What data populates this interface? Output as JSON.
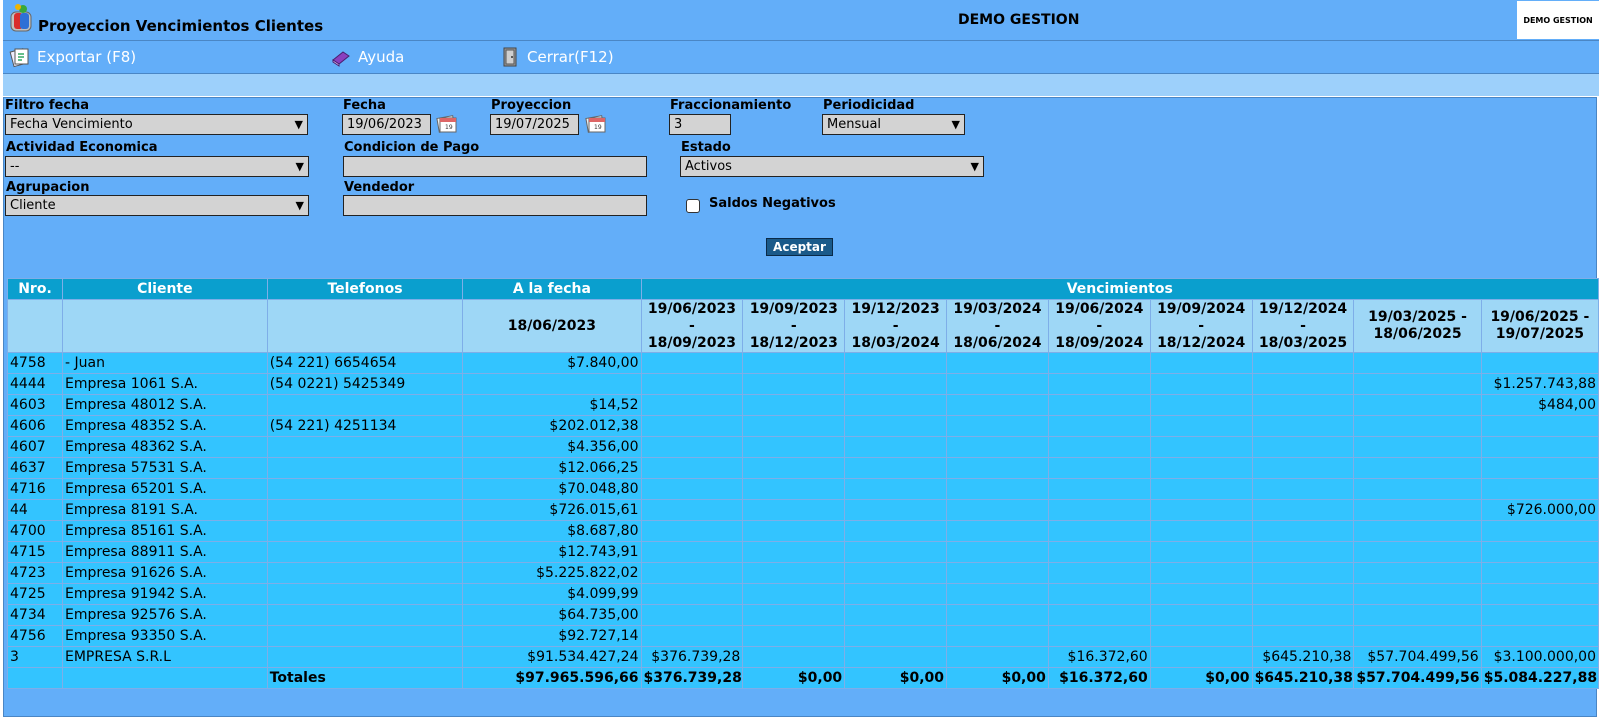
{
  "window": {
    "title": "Proyeccion Vencimientos Clientes",
    "company": "DEMO GESTION",
    "brand_box": "DEMO GESTION"
  },
  "toolbar": {
    "export": "Exportar (F8)",
    "help": "Ayuda",
    "close": "Cerrar(F12)"
  },
  "filters": {
    "filtro_fecha": {
      "label": "Filtro fecha",
      "value": "Fecha Vencimiento"
    },
    "fecha": {
      "label": "Fecha",
      "value": "19/06/2023"
    },
    "proyeccion": {
      "label": "Proyeccion",
      "value": "19/07/2025"
    },
    "fraccionamiento": {
      "label": "Fraccionamiento",
      "value": "3"
    },
    "periodicidad": {
      "label": "Periodicidad",
      "value": "Mensual"
    },
    "actividad": {
      "label": "Actividad Economica",
      "value": "--"
    },
    "condicion": {
      "label": "Condicion de Pago",
      "value": ""
    },
    "estado": {
      "label": "Estado",
      "value": "Activos"
    },
    "agrupacion": {
      "label": "Agrupacion",
      "value": "Cliente"
    },
    "vendedor": {
      "label": "Vendedor",
      "value": ""
    },
    "saldos_negativos": {
      "label": "Saldos Negativos",
      "checked": false
    },
    "accept": "Aceptar"
  },
  "table": {
    "headers": {
      "nro": "Nro.",
      "cliente": "Cliente",
      "telefonos": "Telefonos",
      "a_la_fecha": "A la fecha",
      "vencimientos": "Vencimientos",
      "a_la_fecha_date": "18/06/2023"
    },
    "periods": [
      [
        "19/06/2023",
        "-",
        "18/09/2023"
      ],
      [
        "19/09/2023",
        "-",
        "18/12/2023"
      ],
      [
        "19/12/2023",
        "-",
        "18/03/2024"
      ],
      [
        "19/03/2024",
        "-",
        "18/06/2024"
      ],
      [
        "19/06/2024",
        "-",
        "18/09/2024"
      ],
      [
        "19/09/2024",
        "-",
        "18/12/2024"
      ],
      [
        "19/12/2024",
        "-",
        "18/03/2025"
      ],
      [
        "19/03/2025 -",
        "18/06/2025"
      ],
      [
        "19/06/2025 -",
        "19/07/2025"
      ]
    ],
    "rows": [
      [
        "4758",
        "- Juan",
        "(54 221) 6654654",
        "$7.840,00",
        "",
        "",
        "",
        "",
        "",
        "",
        "",
        "",
        ""
      ],
      [
        "4444",
        "Empresa 1061 S.A.",
        "(54 0221) 5425349",
        "",
        "",
        "",
        "",
        "",
        "",
        "",
        "",
        "",
        "$1.257.743,88"
      ],
      [
        "4603",
        "Empresa 48012 S.A.",
        "",
        "$14,52",
        "",
        "",
        "",
        "",
        "",
        "",
        "",
        "",
        "$484,00"
      ],
      [
        "4606",
        "Empresa 48352 S.A.",
        "(54 221) 4251134",
        "$202.012,38",
        "",
        "",
        "",
        "",
        "",
        "",
        "",
        "",
        ""
      ],
      [
        "4607",
        "Empresa 48362 S.A.",
        "",
        "$4.356,00",
        "",
        "",
        "",
        "",
        "",
        "",
        "",
        "",
        ""
      ],
      [
        "4637",
        "Empresa 57531 S.A.",
        "",
        "$12.066,25",
        "",
        "",
        "",
        "",
        "",
        "",
        "",
        "",
        ""
      ],
      [
        "4716",
        "Empresa 65201 S.A.",
        "",
        "$70.048,80",
        "",
        "",
        "",
        "",
        "",
        "",
        "",
        "",
        ""
      ],
      [
        "44",
        "Empresa 8191 S.A.",
        "",
        "$726.015,61",
        "",
        "",
        "",
        "",
        "",
        "",
        "",
        "",
        "$726.000,00"
      ],
      [
        "4700",
        "Empresa 85161 S.A.",
        "",
        "$8.687,80",
        "",
        "",
        "",
        "",
        "",
        "",
        "",
        "",
        ""
      ],
      [
        "4715",
        "Empresa 88911 S.A.",
        "",
        "$12.743,91",
        "",
        "",
        "",
        "",
        "",
        "",
        "",
        "",
        ""
      ],
      [
        "4723",
        "Empresa 91626 S.A.",
        "",
        "$5.225.822,02",
        "",
        "",
        "",
        "",
        "",
        "",
        "",
        "",
        ""
      ],
      [
        "4725",
        "Empresa 91942 S.A.",
        "",
        "$4.099,99",
        "",
        "",
        "",
        "",
        "",
        "",
        "",
        "",
        ""
      ],
      [
        "4734",
        "Empresa 92576 S.A.",
        "",
        "$64.735,00",
        "",
        "",
        "",
        "",
        "",
        "",
        "",
        "",
        ""
      ],
      [
        "4756",
        "Empresa 93350 S.A.",
        "",
        "$92.727,14",
        "",
        "",
        "",
        "",
        "",
        "",
        "",
        "",
        ""
      ],
      [
        "3",
        "EMPRESA S.R.L",
        "",
        "$91.534.427,24",
        "$376.739,28",
        "",
        "",
        "",
        "$16.372,60",
        "",
        "$645.210,38",
        "$57.704.499,56",
        "$3.100.000,00"
      ]
    ],
    "totals_label": "Totales",
    "totals": [
      "$97.965.596,66",
      "$376.739,28",
      "$0,00",
      "$0,00",
      "$0,00",
      "$16.372,60",
      "$0,00",
      "$645.210,38",
      "$57.704.499,56",
      "$5.084.227,88"
    ]
  }
}
